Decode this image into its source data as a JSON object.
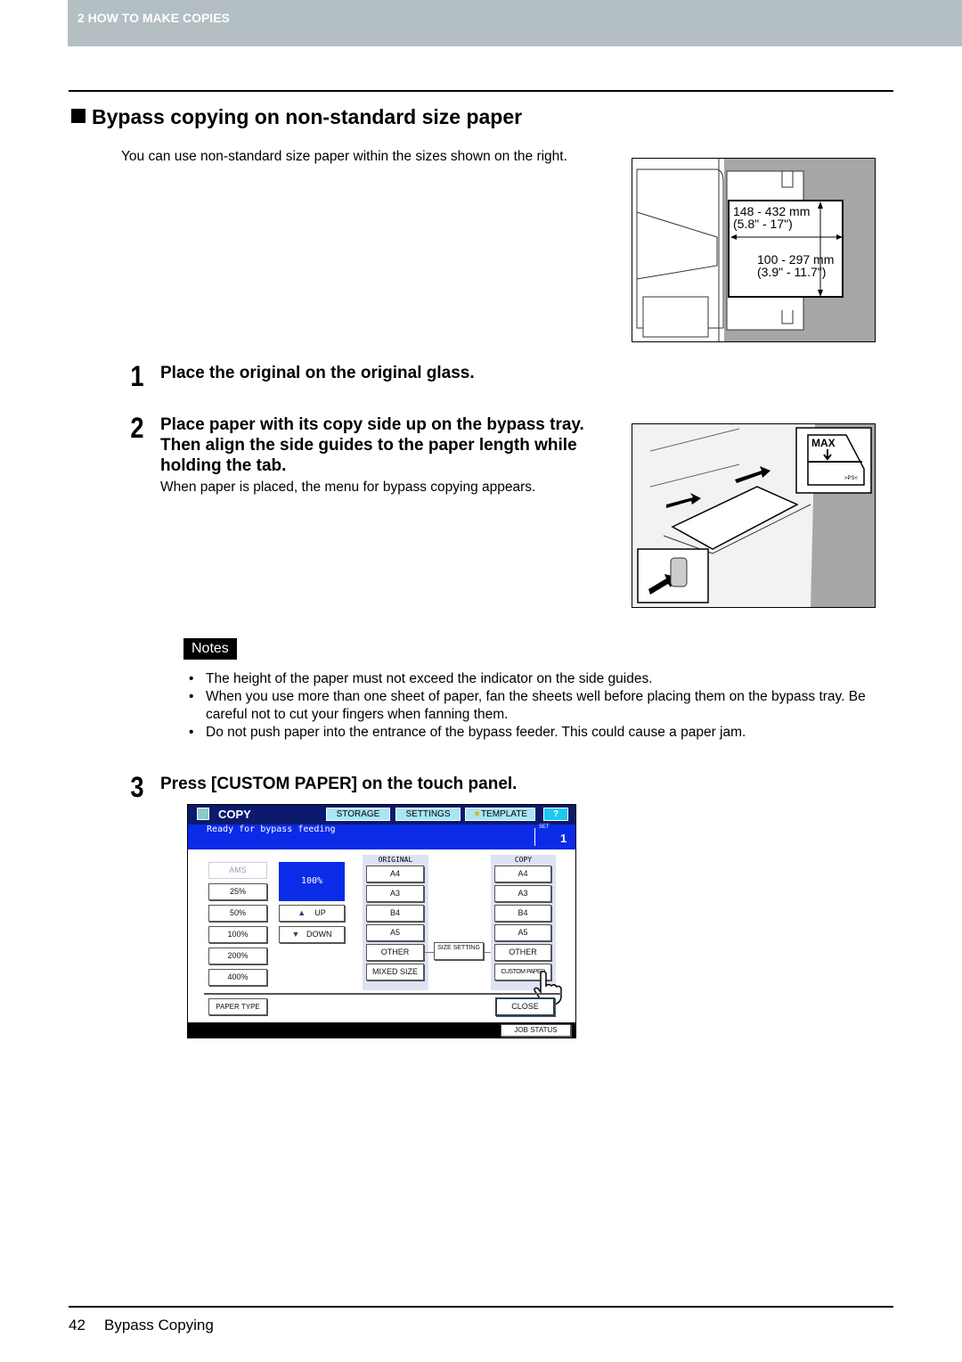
{
  "header": {
    "chapter": "2 HOW TO MAKE COPIES"
  },
  "section": {
    "title": "Bypass copying on non-standard size paper",
    "intro": "You can use non-standard size paper within the sizes shown on the right."
  },
  "size_illustration": {
    "length_mm": "148 - 432 mm",
    "length_in": "(5.8\" - 17\")",
    "width_mm": "100 - 297 mm",
    "width_in": "(3.9\" - 11.7\")"
  },
  "steps": [
    {
      "number": "1",
      "heading": "Place the original on the original glass."
    },
    {
      "number": "2",
      "heading": "Place paper with its copy side up on the bypass tray. Then align the side guides to the paper length while holding the tab.",
      "text": "When paper is placed, the menu for bypass copying appears."
    },
    {
      "number": "3",
      "heading": "Press [CUSTOM PAPER] on the touch panel."
    }
  ],
  "tray_illustration": {
    "max_label": "MAX",
    "marker": ">PS<"
  },
  "notes": {
    "label": "Notes",
    "items": [
      "The height of the paper must not exceed the indicator on the side guides.",
      "When you use more than one sheet of paper, fan the sheets well before placing them on the bypass tray. Be careful not to cut your fingers when fanning them.",
      "Do not push paper into the entrance of the bypass feeder. This could cause a paper jam."
    ]
  },
  "panel": {
    "title": "COPY",
    "tabs": [
      "STORAGE",
      "SETTINGS",
      "TEMPLATE",
      "?"
    ],
    "status": "Ready for bypass feeding",
    "set_label": "SET",
    "set_value": "1",
    "zoom_buttons": [
      "AMS",
      "25%",
      "50%",
      "100%",
      "200%",
      "400%"
    ],
    "zoom_value": "100%",
    "up": "UP",
    "down": "DOWN",
    "original_label": "ORIGINAL",
    "original_sizes": [
      "A4",
      "A3",
      "B4",
      "A5",
      "OTHER",
      "MIXED SIZE"
    ],
    "size_setting": "SIZE SETTING",
    "copy_label": "COPY",
    "copy_sizes": [
      "A4",
      "A3",
      "B4",
      "A5",
      "OTHER",
      "CUSTOM PAPER"
    ],
    "paper_type": "PAPER TYPE",
    "close": "CLOSE",
    "job_status": "JOB STATUS",
    "colors": {
      "title_bar": "#0c1a6e",
      "status_bar": "#0a2be8",
      "tab": "#a9e6f5",
      "selected": "#0a2be8"
    }
  },
  "footer": {
    "page": "42",
    "title": "Bypass Copying"
  }
}
